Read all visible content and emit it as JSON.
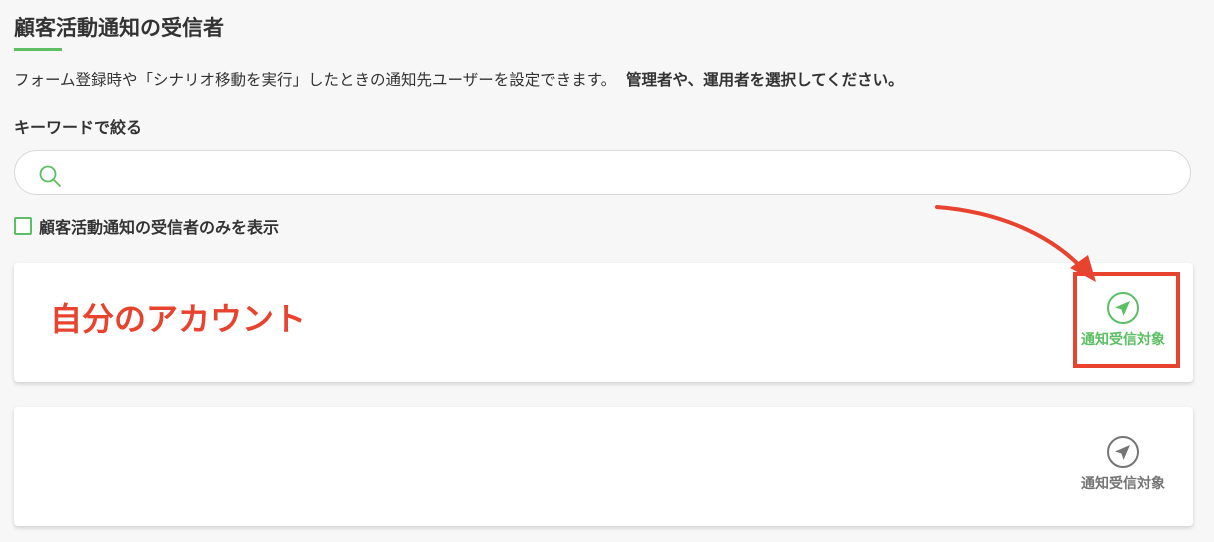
{
  "section": {
    "title": "顧客活動通知の受信者",
    "description_main": "フォーム登録時や「シナリオ移動を実行」したときの通知先ユーザーを設定できます。",
    "description_strong": "管理者や、運用者を選択してください。"
  },
  "filter": {
    "label": "キーワードで絞る",
    "search_value": "",
    "search_placeholder": "",
    "search_icon": "search-icon",
    "checkbox_label": "顧客活動通知の受信者のみを表示",
    "checkbox_checked": false
  },
  "users": [
    {
      "name": "自分のアカウント",
      "notify_label": "通知受信対象",
      "notify_enabled": true,
      "icon": "send-icon"
    },
    {
      "name": "",
      "notify_label": "通知受信対象",
      "notify_enabled": false,
      "icon": "send-icon"
    }
  ],
  "colors": {
    "accent_green": "#5cbf63",
    "annotation_red": "#e8432f",
    "inactive_gray": "#757575"
  }
}
